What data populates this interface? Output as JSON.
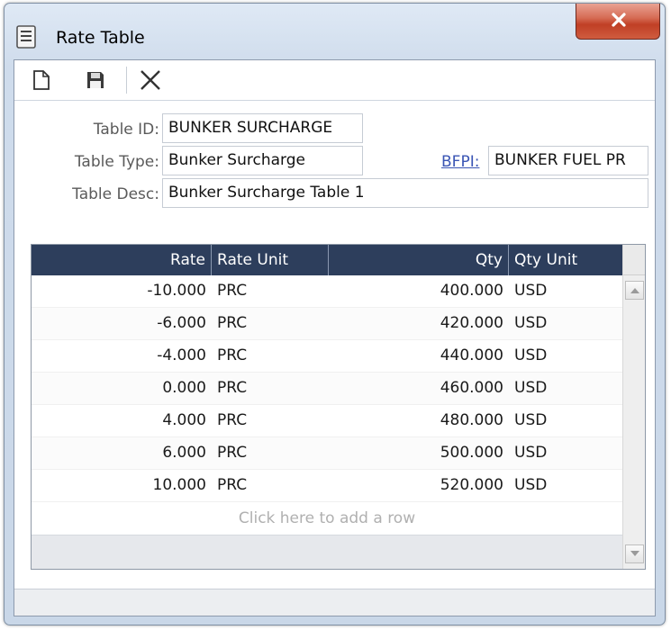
{
  "window": {
    "title": "Rate Table",
    "app_icon": "document-list-icon",
    "close_icon": "close-x-icon"
  },
  "toolbar": {
    "icons": [
      "new-document-icon",
      "save-disk-icon",
      "delete-x-icon"
    ]
  },
  "form": {
    "table_id_label": "Table ID:",
    "table_id_value": "BUNKER SURCHARGE",
    "table_type_label": "Table Type:",
    "table_type_value": "Bunker Surcharge",
    "bfpi_label": "BFPI:",
    "bfpi_value": "BUNKER FUEL PR",
    "table_desc_label": "Table Desc:",
    "table_desc_value": "Bunker Surcharge Table 1"
  },
  "grid": {
    "columns": [
      "Rate",
      "Rate Unit",
      "Qty",
      "Qty Unit"
    ],
    "rows": [
      [
        "-10.000",
        "PRC",
        "400.000",
        "USD"
      ],
      [
        "-6.000",
        "PRC",
        "420.000",
        "USD"
      ],
      [
        "-4.000",
        "PRC",
        "440.000",
        "USD"
      ],
      [
        "0.000",
        "PRC",
        "460.000",
        "USD"
      ],
      [
        "4.000",
        "PRC",
        "480.000",
        "USD"
      ],
      [
        "6.000",
        "PRC",
        "500.000",
        "USD"
      ],
      [
        "10.000",
        "PRC",
        "520.000",
        "USD"
      ]
    ],
    "add_row_text": "Click here to add a row"
  },
  "colors": {
    "header_bg": "#2d3e5c",
    "close_red": "#c03f25",
    "link": "#3a55b4"
  }
}
